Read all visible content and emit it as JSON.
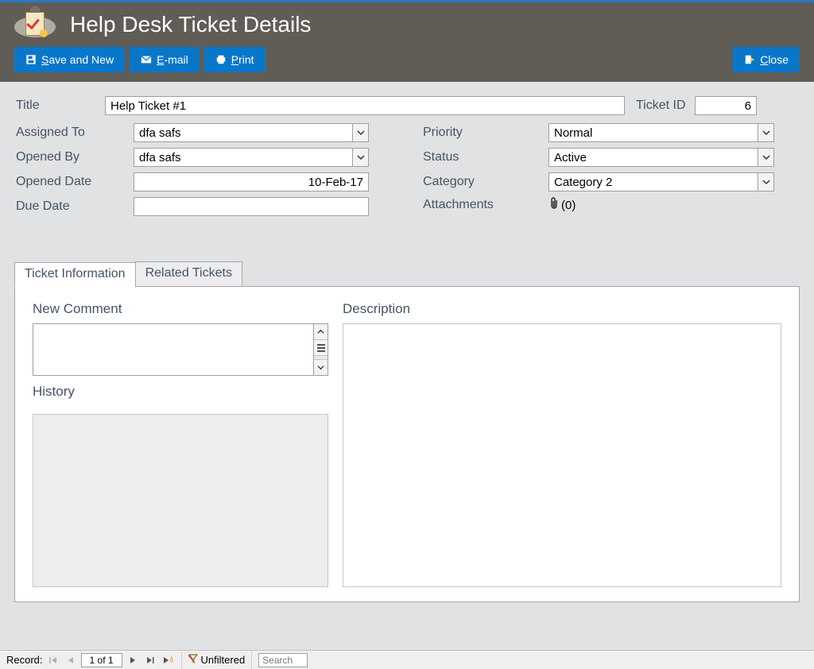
{
  "header": {
    "title": "Help Desk Ticket Details",
    "toolbar": {
      "save_and_new": "Save and New",
      "email": "E-mail",
      "print": "Print",
      "close": "Close"
    }
  },
  "form": {
    "title_label": "Title",
    "title_value": "Help Ticket #1",
    "ticket_id_label": "Ticket ID",
    "ticket_id_value": "6",
    "left": {
      "assigned_to_label": "Assigned To",
      "assigned_to_value": "dfa safs",
      "opened_by_label": "Opened By",
      "opened_by_value": "dfa safs",
      "opened_date_label": "Opened Date",
      "opened_date_value": "10-Feb-17",
      "due_date_label": "Due Date",
      "due_date_value": ""
    },
    "right": {
      "priority_label": "Priority",
      "priority_value": "Normal",
      "status_label": "Status",
      "status_value": "Active",
      "category_label": "Category",
      "category_value": "Category 2",
      "attachments_label": "Attachments",
      "attachments_count": "(0)"
    }
  },
  "tabs": {
    "ticket_info": "Ticket Information",
    "related": "Related Tickets"
  },
  "panel": {
    "new_comment_label": "New Comment",
    "history_label": "History",
    "description_label": "Description"
  },
  "recnav": {
    "label": "Record:",
    "position": "1 of 1",
    "filter_state": "Unfiltered",
    "search_placeholder": "Search"
  }
}
